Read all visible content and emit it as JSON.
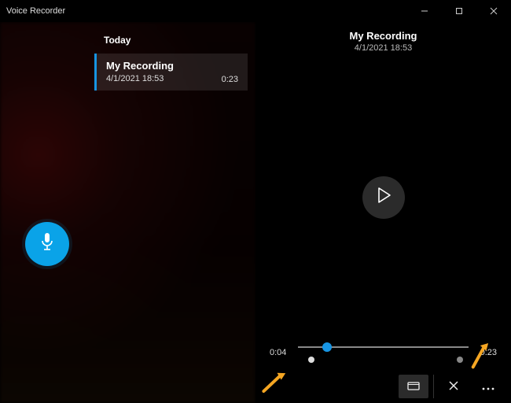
{
  "app": {
    "title": "Voice Recorder"
  },
  "colors": {
    "accent": "#1795e3",
    "recordButton": "#0aa3e8"
  },
  "sidebar": {
    "sectionLabel": "Today",
    "items": [
      {
        "name": "My Recording",
        "timestamp": "4/1/2021 18:53",
        "duration": "0:23"
      }
    ]
  },
  "detail": {
    "title": "My Recording",
    "timestamp": "4/1/2021 18:53",
    "currentTime": "0:04",
    "totalTime": "0:23"
  },
  "icons": {
    "mic": "microphone-icon",
    "play": "play-icon",
    "share": "share-icon",
    "trim": "trim-icon",
    "delete": "delete-icon",
    "more": "more-icon"
  }
}
